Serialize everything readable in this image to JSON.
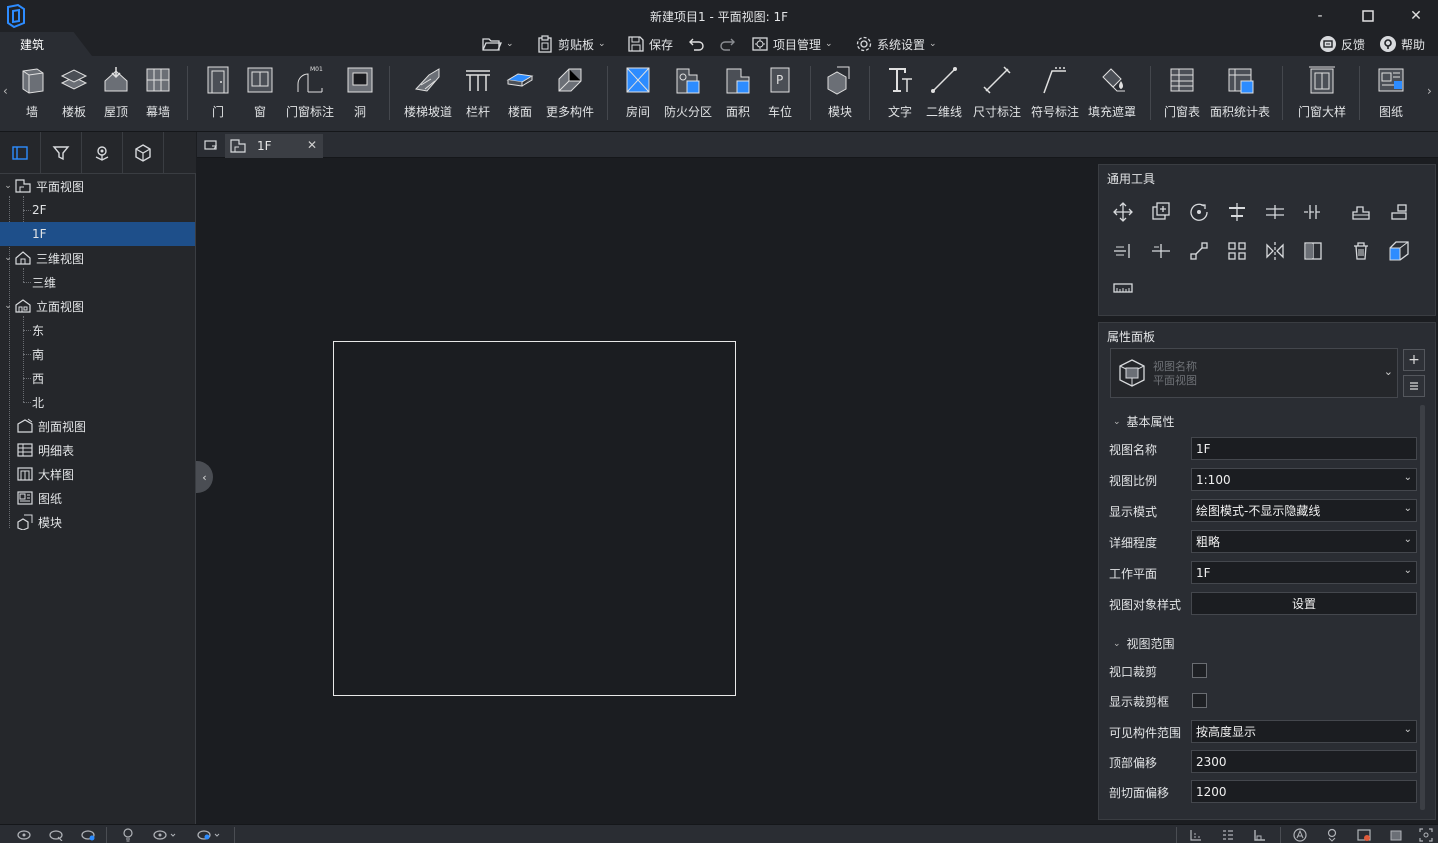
{
  "window": {
    "title": "新建项目1 - 平面视图: 1F",
    "minimize": "-",
    "maximize": "☐",
    "close": "✕"
  },
  "ribbon_tab": "建筑",
  "quickbar": {
    "open_caret": "⌄",
    "clipboard": "剪贴板",
    "save": "保存",
    "project_manage": "项目管理",
    "system_settings": "系统设置",
    "feedback": "反馈",
    "help": "帮助"
  },
  "ribbon": {
    "left_arrow": "‹",
    "right_arrow": "›",
    "buttons": [
      {
        "label": "墙"
      },
      {
        "label": "楼板"
      },
      {
        "label": "屋顶"
      },
      {
        "label": "幕墙"
      },
      {
        "label": "门"
      },
      {
        "label": "窗"
      },
      {
        "label": "门窗标注",
        "badge": "M01"
      },
      {
        "label": "洞"
      },
      {
        "label": "楼梯坡道"
      },
      {
        "label": "栏杆"
      },
      {
        "label": "楼面"
      },
      {
        "label": "更多构件"
      },
      {
        "label": "房间"
      },
      {
        "label": "防火分区"
      },
      {
        "label": "面积"
      },
      {
        "label": "车位",
        "badge": "P"
      },
      {
        "label": "模块"
      },
      {
        "label": "文字"
      },
      {
        "label": "二维线"
      },
      {
        "label": "尺寸标注"
      },
      {
        "label": "符号标注"
      },
      {
        "label": "填充遮罩"
      },
      {
        "label": "门窗表"
      },
      {
        "label": "面积统计表"
      },
      {
        "label": "门窗大样"
      },
      {
        "label": "图纸"
      }
    ]
  },
  "tree": {
    "plan": "平面视图",
    "plan_children": [
      "2F",
      "1F"
    ],
    "threed": "三维视图",
    "threed_children": [
      "三维"
    ],
    "elevation": "立面视图",
    "elevation_children": [
      "东",
      "南",
      "西",
      "北"
    ],
    "section": "剖面视图",
    "schedule": "明细表",
    "detail": "大样图",
    "sheet": "图纸",
    "module": "模块"
  },
  "view_tab": {
    "label": "1F",
    "close": "✕"
  },
  "tools_panel": {
    "title": "通用工具"
  },
  "props": {
    "title": "属性面板",
    "selector_line1": "视图名称",
    "selector_line2": "平面视图",
    "add_btn": "+",
    "basic_section": "基本属性",
    "view_name_label": "视图名称",
    "view_name": "1F",
    "scale_label": "视图比例",
    "scale": "1:100",
    "display_mode_label": "显示模式",
    "display_mode": "绘图模式-不显示隐藏线",
    "detail_level_label": "详细程度",
    "detail_level": "粗略",
    "work_plane_label": "工作平面",
    "work_plane": "1F",
    "obj_style_label": "视图对象样式",
    "obj_style_btn": "设置",
    "range_section": "视图范围",
    "crop_label": "视口裁剪",
    "crop_frame_label": "显示裁剪框",
    "visible_range_label": "可见构件范围",
    "visible_range": "按高度显示",
    "top_offset_label": "顶部偏移",
    "top_offset": "2300",
    "cut_offset_label": "剖切面偏移",
    "cut_offset": "1200"
  }
}
